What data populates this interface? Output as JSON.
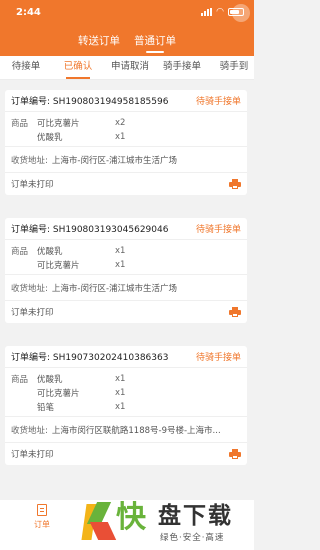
{
  "status_bar": {
    "time": "2:44"
  },
  "mode_tabs": [
    {
      "label": "转送订单",
      "active": false
    },
    {
      "label": "普通订单",
      "active": true
    }
  ],
  "status_tabs": [
    {
      "label": "待接单",
      "active": false
    },
    {
      "label": "已确认",
      "active": true
    },
    {
      "label": "申请取消",
      "active": false
    },
    {
      "label": "骑手接单",
      "active": false
    },
    {
      "label": "骑手到",
      "active": false
    }
  ],
  "labels": {
    "goods": "商品",
    "address": "收货地址:"
  },
  "orders": [
    {
      "order_no": "订单编号: SH190803194958185596",
      "status": "待骑手接单",
      "items": [
        {
          "name": "可比克薯片",
          "qty": "x2"
        },
        {
          "name": "优酸乳",
          "qty": "x1"
        }
      ],
      "address": "上海市-闵行区-浦江城市生活广场",
      "print_status": "订单未打印"
    },
    {
      "order_no": "订单编号: SH190803193045629046",
      "status": "待骑手接单",
      "items": [
        {
          "name": "优酸乳",
          "qty": "x1"
        },
        {
          "name": "可比克薯片",
          "qty": "x1"
        }
      ],
      "address": "上海市-闵行区-浦江城市生活广场",
      "print_status": "订单未打印"
    },
    {
      "order_no": "订单编号: SH190730202410386363",
      "status": "待骑手接单",
      "items": [
        {
          "name": "优酸乳",
          "qty": "x1"
        },
        {
          "name": "可比克薯片",
          "qty": "x1"
        },
        {
          "name": "铅笔",
          "qty": "x1"
        }
      ],
      "address": "上海市闵行区联航路1188号-9号楼-上海市...",
      "print_status": "订单未打印"
    }
  ],
  "bottom_nav": {
    "label": "订单"
  },
  "watermark": {
    "brand_big": "快",
    "brand": "盘下载",
    "slogan": "绿色·安全·高速"
  },
  "colors": {
    "accent": "#f0772c",
    "background": "#f2f2f2"
  },
  "icons": [
    "signal-icon",
    "wifi-icon",
    "battery-icon",
    "printer-icon",
    "order-doc-icon"
  ]
}
